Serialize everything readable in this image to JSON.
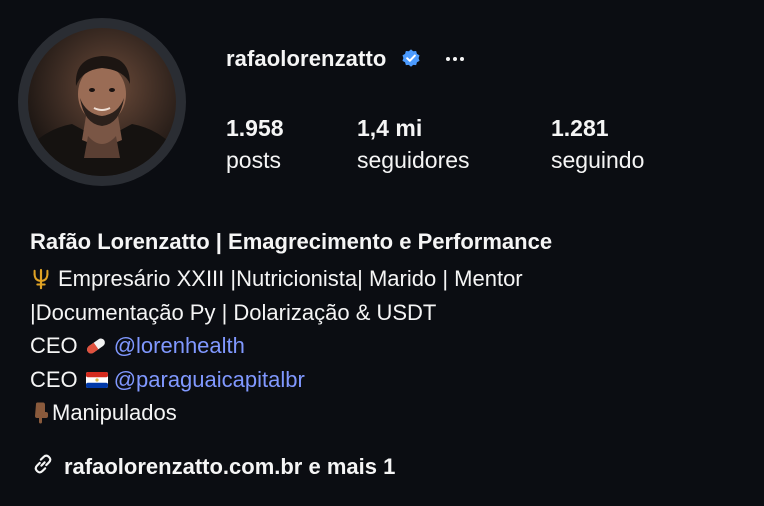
{
  "profile": {
    "username": "rafaolorenzatto",
    "verified": true,
    "more_icon": "ellipsis-icon",
    "avatar_alt": "profile-photo"
  },
  "stats": {
    "posts": {
      "value": "1.958",
      "label": "posts"
    },
    "followers": {
      "value": "1,4 mi",
      "label": "seguidores"
    },
    "following": {
      "value": "1.281",
      "label": "seguindo"
    }
  },
  "bio": {
    "full_name": "Rafão Lorenzatto | Emagrecimento e Performance",
    "line1_emoji": "trident-emoji",
    "line1": "Empresário XXIII |Nutricionista| Marido | Mentor",
    "line2": "|Documentação Py | Dolarização & USDT",
    "line3_prefix": "CEO",
    "line3_emoji": "pill-emoji",
    "line3_mention": "@lorenhealth",
    "line4_prefix": "CEO",
    "line4_emoji": "paraguay-flag-emoji",
    "line4_mention": "@paraguaicapitalbr",
    "line5_emoji": "pointing-down-emoji",
    "line5": "Manipulados"
  },
  "link": {
    "icon": "link-icon",
    "text": "rafaolorenzatto.com.br e mais 1"
  },
  "colors": {
    "background": "#0b0d12",
    "text": "#f5f5f5",
    "mention": "#8098ff",
    "verified": "#4c9bff"
  }
}
